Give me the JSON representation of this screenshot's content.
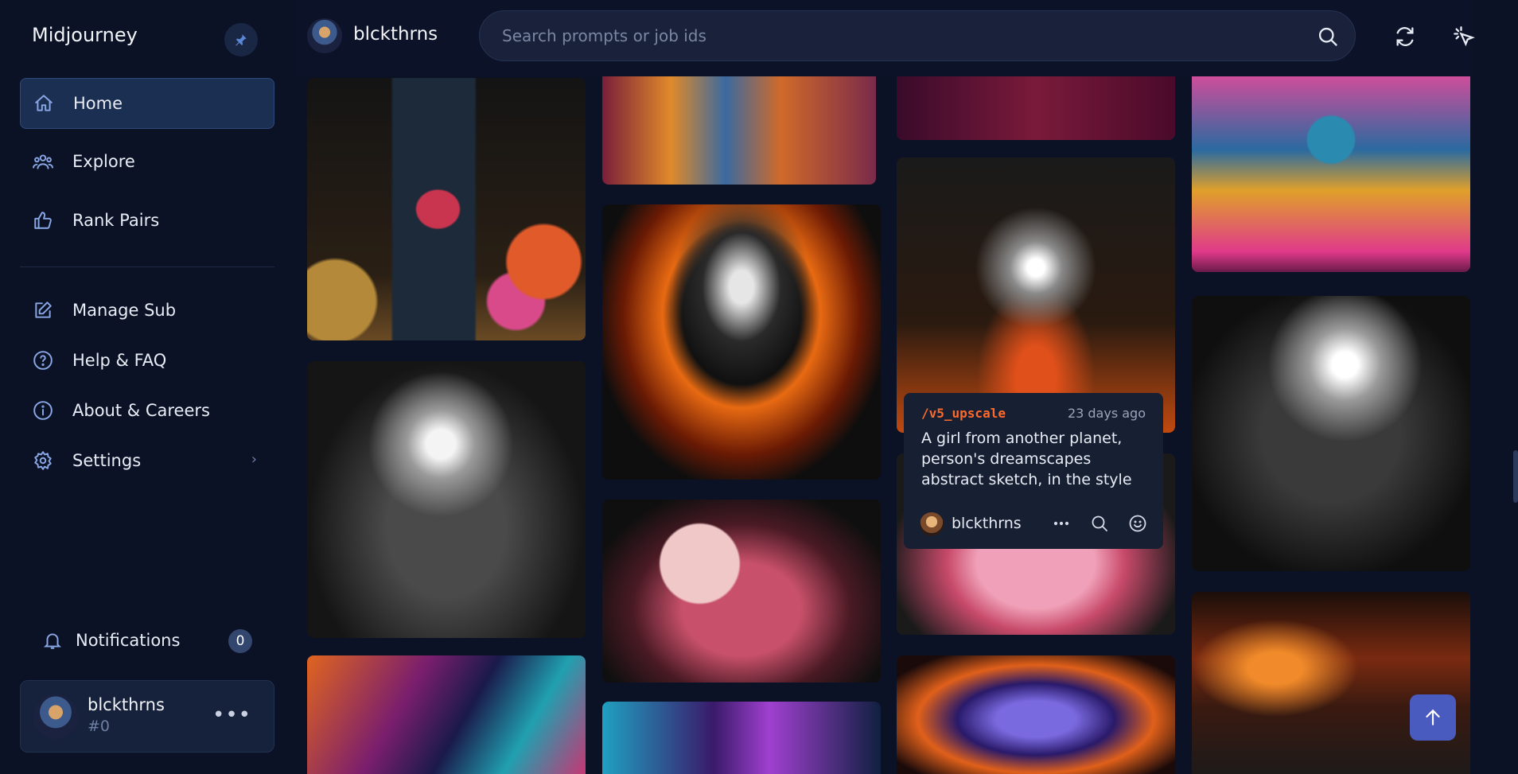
{
  "sidebar": {
    "brand": "Midjourney",
    "items": [
      {
        "label": "Home",
        "icon": "home-icon"
      },
      {
        "label": "Explore",
        "icon": "people-icon"
      },
      {
        "label": "Rank Pairs",
        "icon": "thumbs-up-icon"
      },
      {
        "label": "Manage Sub",
        "icon": "edit-icon"
      },
      {
        "label": "Help & FAQ",
        "icon": "help-icon"
      },
      {
        "label": "About & Careers",
        "icon": "info-icon"
      },
      {
        "label": "Settings",
        "icon": "gear-icon"
      }
    ],
    "notifications_label": "Notifications",
    "notifications_count": "0",
    "user": {
      "name": "blckthrns",
      "tag": "#0"
    }
  },
  "header": {
    "username": "blckthrns",
    "search_placeholder": "Search prompts or job ids"
  },
  "hover_card": {
    "command": "/v5_upscale",
    "time": "23 days ago",
    "prompt": "A girl from another planet, person's dreamscapes abstract sketch, in the style of surrealistic",
    "user": "blckthrns"
  },
  "colors": {
    "background": "#0b1226",
    "active_nav": "#1b2f52",
    "accent_icon": "#8aa7e6",
    "command": "#ff6a2a",
    "scroll_button": "#4a5bbf"
  }
}
